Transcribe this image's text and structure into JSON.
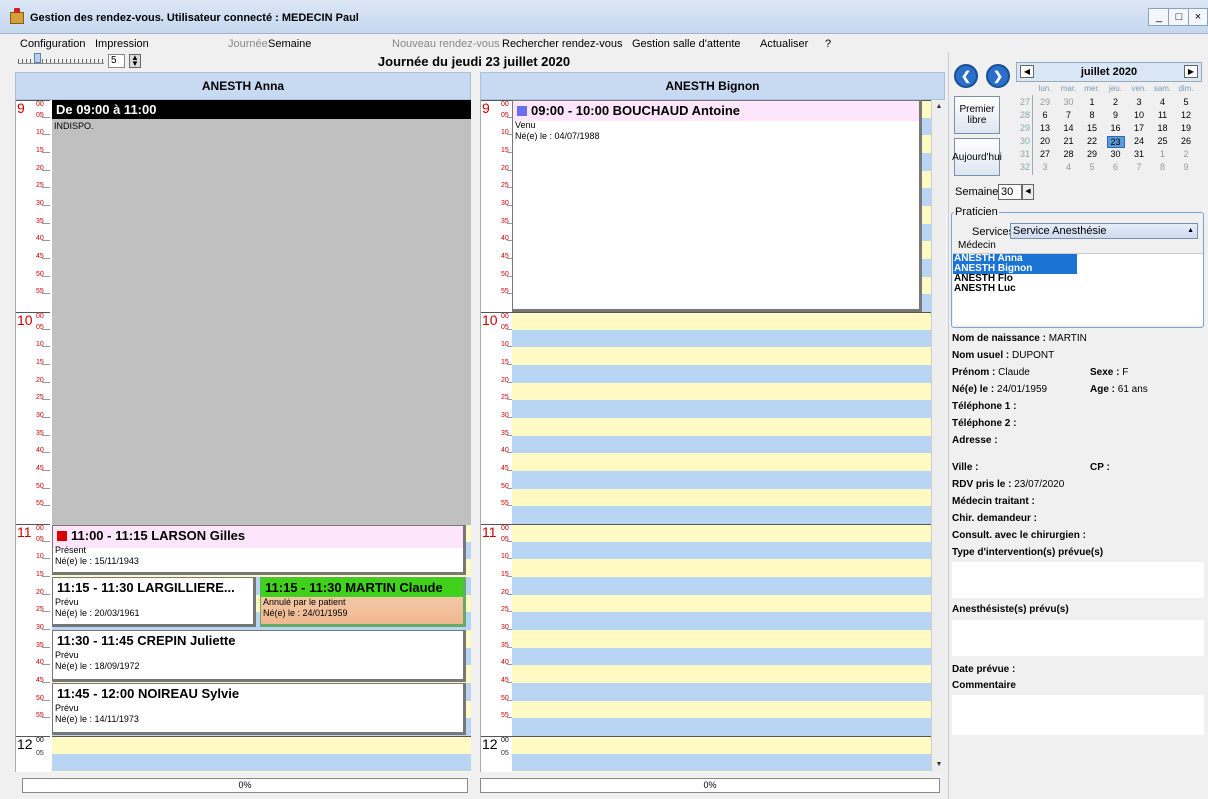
{
  "window": {
    "title": "Gestion des rendez-vous.   Utilisateur connecté : MEDECIN Paul",
    "min": "_",
    "max": "□",
    "close": "×"
  },
  "menu": {
    "configuration": "Configuration",
    "impression": "Impression",
    "journee": "Journée",
    "semaine": "Semaine",
    "nouveau": "Nouveau rendez-vous",
    "rechercher": "Rechercher rendez-vous",
    "salle": "Gestion salle d'attente",
    "actualiser": "Actualiser",
    "help": "?"
  },
  "zoom": {
    "value": "5",
    "level_fraction": 0.2
  },
  "day_heading": "Journée du jeudi 23 juillet 2020",
  "columns": [
    {
      "name": "ANESTH Anna"
    },
    {
      "name": "ANESTH Bignon"
    }
  ],
  "hours": [
    "9",
    "10",
    "11",
    "12"
  ],
  "hour_sup": "00",
  "minutes": [
    "05",
    "10",
    "15",
    "20",
    "25",
    "30",
    "35",
    "40",
    "45",
    "50",
    "55"
  ],
  "anna": {
    "block": {
      "head": "De 09:00 à 11:00",
      "text": "INDISPO."
    },
    "appts": [
      {
        "head": "11:00 - 11:15 LARSON Gilles",
        "status": "Présent",
        "birth": "Né(e) le : 15/11/1943"
      },
      {
        "head": "11:15 - 11:30 LARGILLIERE...",
        "status": "Prévu",
        "birth": "Né(e) le : 20/03/1961"
      },
      {
        "head": "11:15 - 11:30 MARTIN Claude",
        "status": "Annulé par le patient",
        "birth": "Né(e) le : 24/01/1959"
      },
      {
        "head": "11:30 - 11:45 CREPIN Juliette",
        "status": "Prévu",
        "birth": "Né(e) le : 18/09/1972"
      },
      {
        "head": "11:45 - 12:00 NOIREAU Sylvie",
        "status": "Prévu",
        "birth": "Né(e) le : 14/11/1973"
      }
    ]
  },
  "bignon": {
    "appt": {
      "head": "09:00 - 10:00 BOUCHAUD Antoine",
      "status": "Venu",
      "birth": "Né(e) le : 04/07/1988"
    }
  },
  "progress": [
    "0%",
    "0%"
  ],
  "calendar": {
    "month": "juillet 2020",
    "dow": [
      "lun.",
      "mar.",
      "mer.",
      "jeu.",
      "ven.",
      "sam.",
      "dim."
    ],
    "weeks": [
      "27",
      "28",
      "29",
      "30",
      "31",
      "32"
    ],
    "days": [
      [
        "29",
        "30",
        "1",
        "2",
        "3",
        "4",
        "5"
      ],
      [
        "6",
        "7",
        "8",
        "9",
        "10",
        "11",
        "12"
      ],
      [
        "13",
        "14",
        "15",
        "16",
        "17",
        "18",
        "19"
      ],
      [
        "20",
        "21",
        "22",
        "23",
        "24",
        "25",
        "26"
      ],
      [
        "27",
        "28",
        "29",
        "30",
        "31",
        "1",
        "2"
      ],
      [
        "3",
        "4",
        "5",
        "6",
        "7",
        "8",
        "9"
      ]
    ],
    "selected": "23"
  },
  "buttons": {
    "premier": "Premier libre",
    "aujourdhui": "Aujourd'hui"
  },
  "semaine": {
    "label": "Semaine",
    "value": "30"
  },
  "praticien": {
    "legend": "Praticien",
    "services_label": "Services",
    "services_value": "Service Anesthésie",
    "medecin_label": "Médecin",
    "list": [
      {
        "name": "ANESTH Anna",
        "selected": true
      },
      {
        "name": "ANESTH Bignon",
        "selected": true
      },
      {
        "name": "ANESTH Flo",
        "selected": false
      },
      {
        "name": "ANESTH Luc",
        "selected": false
      }
    ]
  },
  "patient": {
    "nom_naissance_label": "Nom de naissance :",
    "nom_naissance": "MARTIN",
    "nom_usuel_label": "Nom usuel :",
    "nom_usuel": "DUPONT",
    "prenom_label": "Prénom :",
    "prenom": "Claude",
    "sexe_label": "Sexe :",
    "sexe": "F",
    "ne_label": "Né(e) le :",
    "ne": "24/01/1959",
    "age_label": "Age :",
    "age": "61 ans",
    "tel1_label": "Téléphone 1 :",
    "tel2_label": "Téléphone 2 :",
    "adresse_label": "Adresse :",
    "ville_label": "Ville :",
    "cp_label": "CP :",
    "rdv_label": "RDV pris le :",
    "rdv": "23/07/2020",
    "medecin_label": "Médecin traitant :",
    "chir_label": "Chir. demandeur :",
    "consult_label": "Consult. avec le chirurgien :",
    "type_label": "Type d'intervention(s) prévue(s)",
    "anesth_label": "Anesthésiste(s) prévu(s)",
    "date_label": "Date prévue :",
    "comment_label": "Commentaire"
  }
}
